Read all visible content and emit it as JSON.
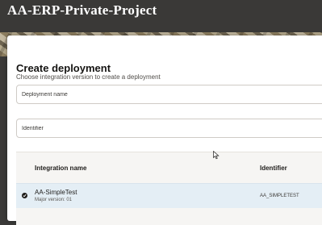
{
  "app": {
    "title": "AA-ERP-Private-Project"
  },
  "drawer": {
    "title": "Create deployment",
    "subtitle": "Choose integration version to create a deployment",
    "fields": {
      "deployment_name": {
        "placeholder": "Deployment name",
        "value": ""
      },
      "identifier": {
        "placeholder": "Identifier",
        "value": ""
      }
    },
    "table": {
      "columns": [
        "Integration name",
        "Identifier"
      ],
      "rows": [
        {
          "name": "AA-SimpleTest",
          "version": "Major version: 01",
          "identifier": "AA_SIMPLETEST",
          "selected": true
        }
      ]
    }
  },
  "icons": {
    "row_selected": "check-icon",
    "pointer": "mouse-cursor-icon"
  },
  "colors": {
    "topbar": "#3a3937",
    "selected_row": "#e4eef5",
    "table_bg": "#f6f5f3"
  }
}
